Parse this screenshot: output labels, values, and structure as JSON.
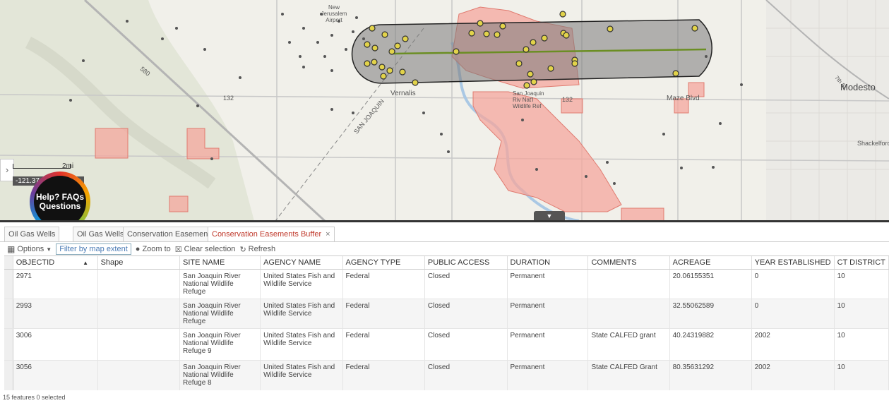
{
  "map": {
    "labels": {
      "modesto": "Modesto",
      "vernalis": "Vernalis",
      "new_jerusalem": "New Jerusalem Airport",
      "refuge": "San Joaquin Riv Nat'l Wildlife Ref",
      "maze_blvd": "Maze Blvd",
      "hwy_132_a": "132",
      "hwy_132_b": "132",
      "hwy_580": "580",
      "san_joaquin_road": "SAN JOAQUIN",
      "shackelford": "Shackelford",
      "seventh_st": "7th St"
    },
    "scale_label": "2mi",
    "coord_readout": "-121.37",
    "coord_suffix": "ees",
    "help_button": "Help? FAQs Questions",
    "side_toggle": "›",
    "collapse_toggle": "▼"
  },
  "tabs": [
    {
      "label": "Oil Gas Wells",
      "active": false
    },
    {
      "label": "Oil Gas Wells",
      "active": false
    },
    {
      "label": "Conservation Easements",
      "active": false
    },
    {
      "label": "Conservation Easements Buffer",
      "active": true,
      "close": "×"
    }
  ],
  "toolbar": {
    "options": "Options",
    "filter": "Filter by map extent",
    "zoom": "Zoom to",
    "clear": "Clear selection",
    "refresh": "Refresh"
  },
  "table": {
    "columns": [
      "OBJECTID",
      "Shape",
      "SITE NAME",
      "AGENCY NAME",
      "AGENCY TYPE",
      "PUBLIC ACCESS",
      "DURATION",
      "COMMENTS",
      "ACREAGE",
      "YEAR ESTABLISHED",
      "CT DISTRICT"
    ],
    "sort_indicator": "▲",
    "rows": [
      [
        "2971",
        "",
        "San Joaquin River National Wildlife Refuge",
        "United States Fish and Wildlife Service",
        "Federal",
        "Closed",
        "Permanent",
        "",
        "20.06155351",
        "0",
        "10"
      ],
      [
        "2993",
        "",
        "San Joaquin River National Wildlife Refuge",
        "United States Fish and Wildlife Service",
        "Federal",
        "Closed",
        "Permanent",
        "",
        "32.55062589",
        "0",
        "10"
      ],
      [
        "3006",
        "",
        "San Joaquin River National Wildlife Refuge 9",
        "United States Fish and Wildlife Service",
        "Federal",
        "Closed",
        "Permanent",
        "State CALFED grant",
        "40.24319882",
        "2002",
        "10"
      ],
      [
        "3056",
        "",
        "San Joaquin River National Wildlife Refuge 8",
        "United States Fish and Wildlife Service",
        "Federal",
        "Closed",
        "Permanent",
        "State CALFED Grant",
        "80.35631292",
        "2002",
        "10"
      ]
    ]
  },
  "status": "15 features 0 selected",
  "colors": {
    "easement_fill": "#f4a79e",
    "buffer_fill": "#7a7a7a",
    "well_fill": "#e2d34a",
    "active_tab": "#c0392b"
  }
}
